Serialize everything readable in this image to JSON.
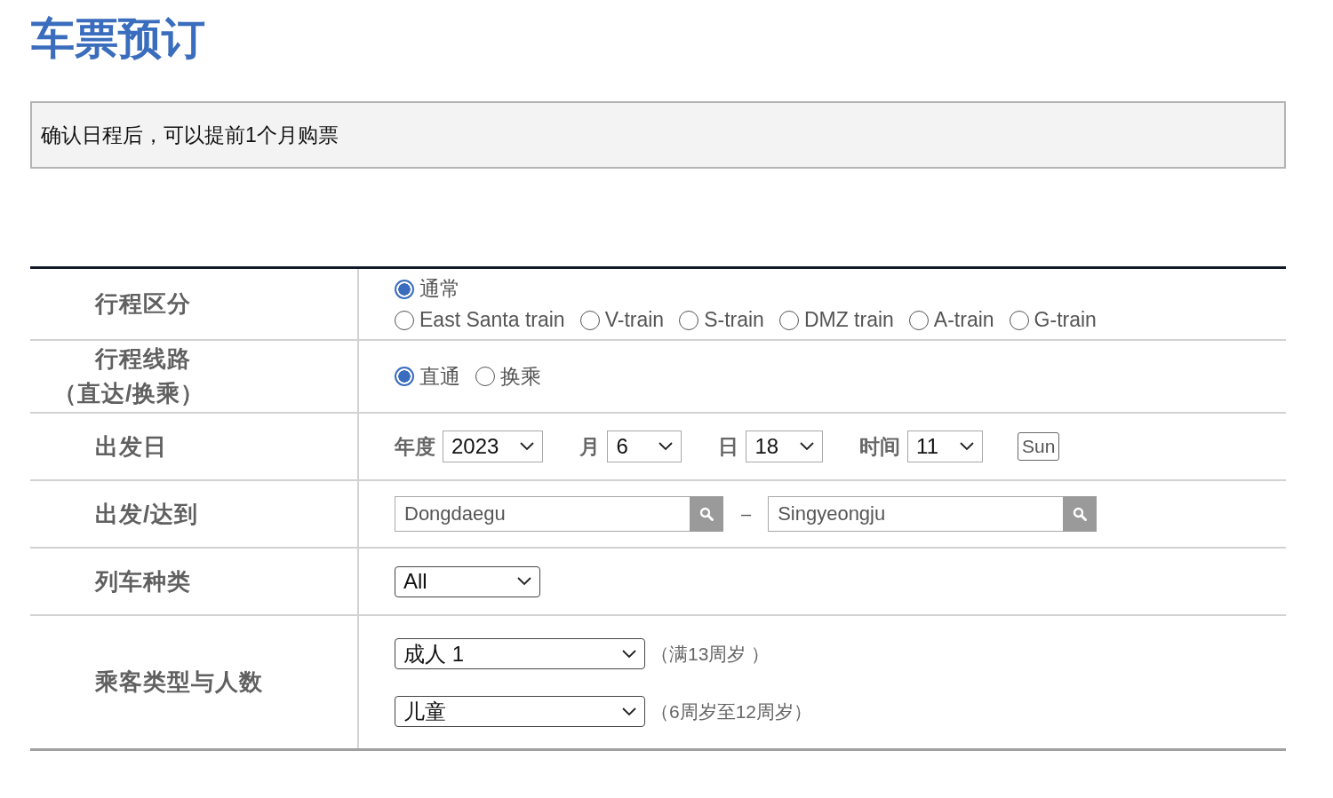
{
  "title": "车票预订",
  "notice": "确认日程后，可以提前1个月购票",
  "form_rows": [
    {
      "kind": "radio_lines",
      "label_lines": [
        "行程区分"
      ],
      "lines": [
        [
          {
            "label": "通常",
            "selected": true
          }
        ],
        [
          {
            "label": "East Santa train",
            "selected": false
          },
          {
            "label": "V-train",
            "selected": false
          },
          {
            "label": "S-train",
            "selected": false
          },
          {
            "label": "DMZ train",
            "selected": false
          },
          {
            "label": "A-train",
            "selected": false
          },
          {
            "label": "G-train",
            "selected": false
          }
        ]
      ]
    },
    {
      "kind": "radio_lines",
      "label_lines": [
        "行程线路",
        "（直达/换乘）"
      ],
      "lines": [
        [
          {
            "label": "直通",
            "selected": true
          },
          {
            "label": "换乘",
            "selected": false
          }
        ]
      ]
    },
    {
      "kind": "date",
      "label_lines": [
        "出发日"
      ],
      "parts": [
        {
          "label": "年度",
          "value": "2023"
        },
        {
          "label": "月",
          "value": "6"
        },
        {
          "label": "日",
          "value": "18"
        },
        {
          "label": "时间",
          "value": "11"
        }
      ],
      "weekday": "Sun"
    },
    {
      "kind": "stations",
      "label_lines": [
        "出发/达到"
      ],
      "departure": {
        "value": "Dongdaegu"
      },
      "separator": "–",
      "arrival": {
        "value": "Singyeongju"
      }
    },
    {
      "kind": "select",
      "label_lines": [
        "列车种类"
      ],
      "value": "All"
    },
    {
      "kind": "passengers",
      "label_lines": [
        "乘客类型与人数"
      ],
      "entries": [
        {
          "value": "成人 1",
          "note": "（满13周岁 ）"
        },
        {
          "value": "儿童",
          "note": "（6周岁至12周岁）"
        }
      ]
    }
  ]
}
